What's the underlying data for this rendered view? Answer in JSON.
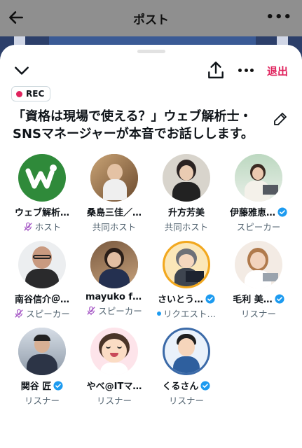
{
  "background": {
    "title": "ポスト",
    "more": "•••"
  },
  "sheet": {
    "leave_label": "退出",
    "rec_label": "REC",
    "title": "「資格は現場で使える？」ウェブ解析士・SNSマネージャーが本音でお話しします。"
  },
  "participants": [
    {
      "name": "ウェブ解析…",
      "role": "ホスト",
      "verified": false,
      "role_icon": "mic-muted-icon"
    },
    {
      "name": "桑島三佳／…",
      "role": "共同ホスト",
      "verified": false,
      "role_icon": ""
    },
    {
      "name": "升方芳美",
      "role": "共同ホスト",
      "verified": false,
      "role_icon": ""
    },
    {
      "name": "伊藤雅恵…",
      "role": "スピーカー",
      "verified": true,
      "role_icon": ""
    },
    {
      "name": "南谷信介＠…",
      "role": "スピーカー",
      "verified": false,
      "role_icon": "mic-muted-icon"
    },
    {
      "name": "mayuko fu…",
      "role": "スピーカー",
      "verified": false,
      "role_icon": "mic-muted-icon"
    },
    {
      "name": "さいとう…",
      "role": "リクエスト…",
      "verified": true,
      "role_icon": "request-dot"
    },
    {
      "name": "毛利 美…",
      "role": "リスナー",
      "verified": true,
      "role_icon": ""
    },
    {
      "name": "関谷 匠",
      "role": "リスナー",
      "verified": true,
      "role_icon": ""
    },
    {
      "name": "やべ@ITマ…",
      "role": "リスナー",
      "verified": false,
      "role_icon": ""
    },
    {
      "name": "くるさん",
      "role": "リスナー",
      "verified": true,
      "role_icon": ""
    }
  ],
  "colors": {
    "accent_red": "#e0245e",
    "verified_blue": "#1d9bf0",
    "muted_purple": "#a557c5"
  }
}
